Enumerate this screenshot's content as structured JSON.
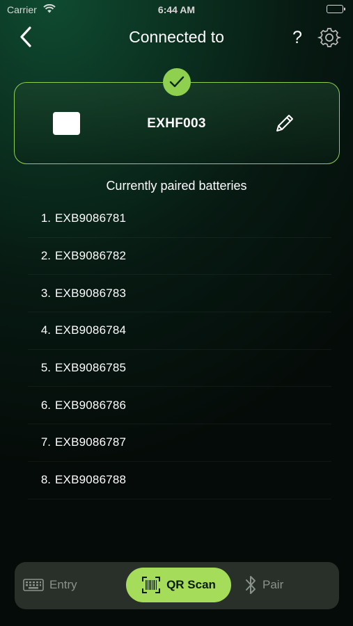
{
  "status_bar": {
    "carrier": "Carrier",
    "time": "6:44 AM"
  },
  "nav": {
    "title": "Connected to",
    "help_label": "?"
  },
  "device": {
    "name": "EXHF003"
  },
  "batteries": {
    "heading": "Currently paired batteries",
    "items": [
      {
        "num": "1.",
        "code": "EXB9086781"
      },
      {
        "num": "2.",
        "code": "EXB9086782"
      },
      {
        "num": "3.",
        "code": "EXB9086783"
      },
      {
        "num": "4.",
        "code": "EXB9086784"
      },
      {
        "num": "5.",
        "code": "EXB9086785"
      },
      {
        "num": "6.",
        "code": "EXB9086786"
      },
      {
        "num": "7.",
        "code": "EXB9086787"
      },
      {
        "num": "8.",
        "code": "EXB9086788"
      }
    ]
  },
  "tabs": {
    "entry": "Entry",
    "qr_scan": "QR Scan",
    "pair": "Pair",
    "active": "qr_scan"
  },
  "colors": {
    "accent": "#8fd14f",
    "active_tab": "#a5dd5a",
    "tab_bar": "#283029"
  }
}
